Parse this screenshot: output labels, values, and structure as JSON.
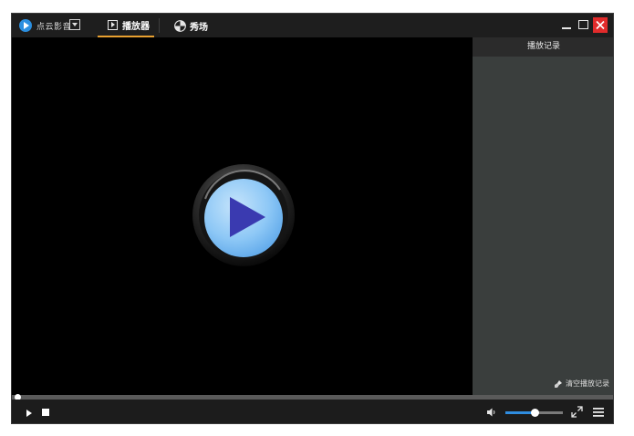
{
  "app": {
    "name": "点云影音"
  },
  "tabs": [
    {
      "label": "播放器",
      "active": true
    },
    {
      "label": "秀场",
      "active": false
    }
  ],
  "sidebar": {
    "title": "播放记录",
    "clear_label": "清空播放记录"
  },
  "player": {
    "progress": 0.0,
    "volume": 0.5
  },
  "colors": {
    "accent": "#2f8de0",
    "tab_underline": "#e8a030",
    "close_button": "#e22b2b",
    "sidebar_bg": "#3a3e3d",
    "video_bg": "#000000"
  },
  "icons": {
    "logo": "play-circle-icon",
    "play_tab": "play-square-icon",
    "show_tab": "pinwheel-icon",
    "volume": "speaker-icon",
    "fullscreen": "expand-arrows-icon",
    "playlist": "list-icon",
    "clear": "broom-icon"
  }
}
